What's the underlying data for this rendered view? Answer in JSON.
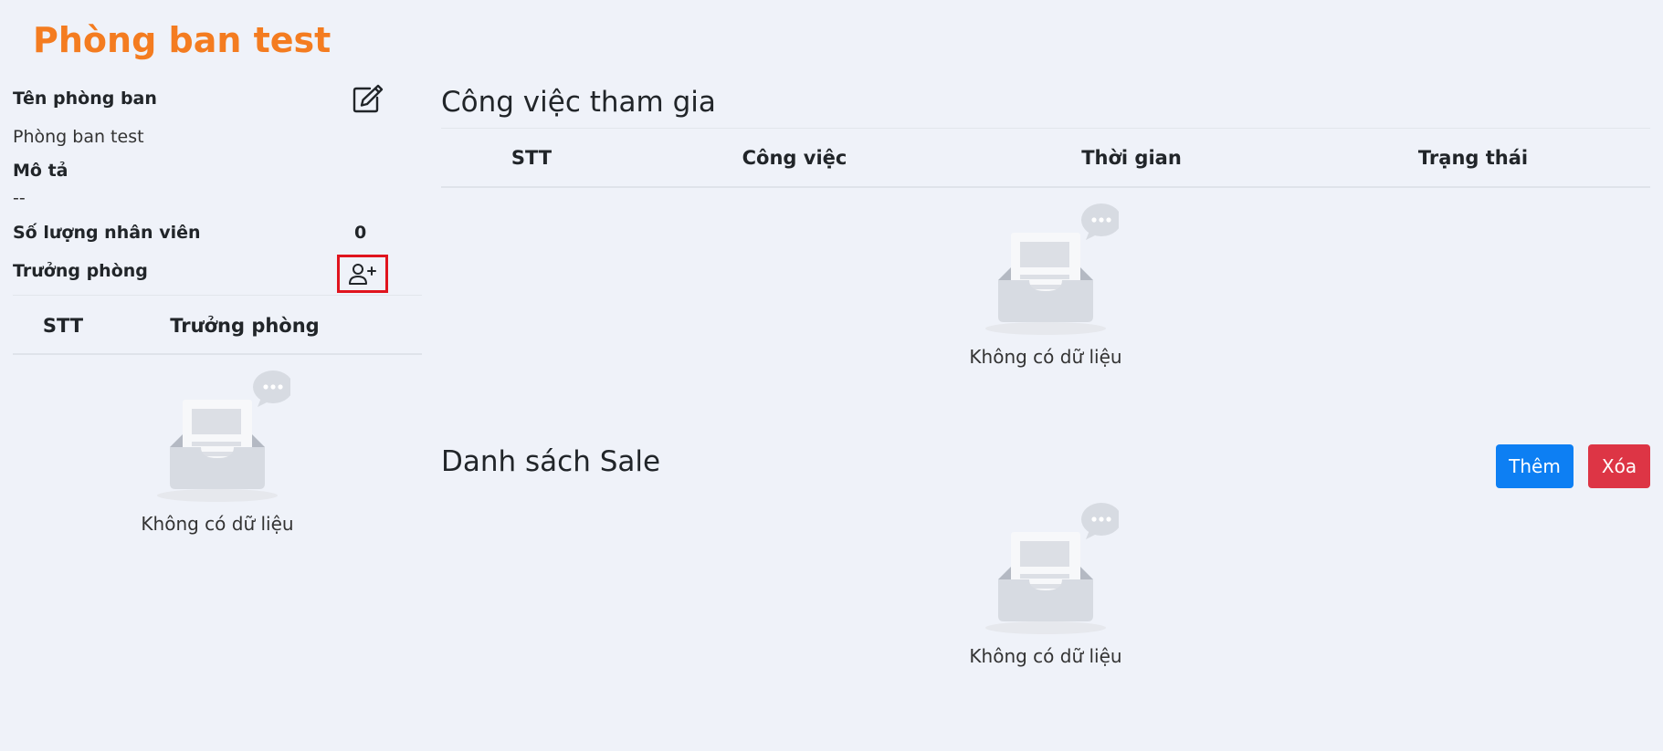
{
  "page": {
    "title": "Phòng ban test"
  },
  "info": {
    "name_label": "Tên phòng ban",
    "name_value": "Phòng ban test",
    "desc_label": "Mô tả",
    "desc_value": "--",
    "count_label": "Số lượng nhân viên",
    "count_value": "0",
    "head_label": "Trưởng phòng"
  },
  "head_table": {
    "columns": [
      "STT",
      "Trưởng phòng"
    ],
    "empty_text": "Không có dữ liệu"
  },
  "jobs": {
    "title": "Công việc tham gia",
    "columns": [
      "STT",
      "Công việc",
      "Thời gian",
      "Trạng thái"
    ],
    "empty_text": "Không có dữ liệu"
  },
  "sales": {
    "title": "Danh sách Sale",
    "add_label": "Thêm",
    "delete_label": "Xóa",
    "empty_text": "Không có dữ liệu"
  },
  "icons": {
    "edit": "edit-icon",
    "add_user": "person-plus-icon",
    "empty": "empty-inbox-icon"
  },
  "colors": {
    "title": "#f47c20",
    "add_button": "#0d7ff3",
    "delete_button": "#dd3545",
    "highlight_border": "#e0141e",
    "background": "#eff2f9"
  }
}
